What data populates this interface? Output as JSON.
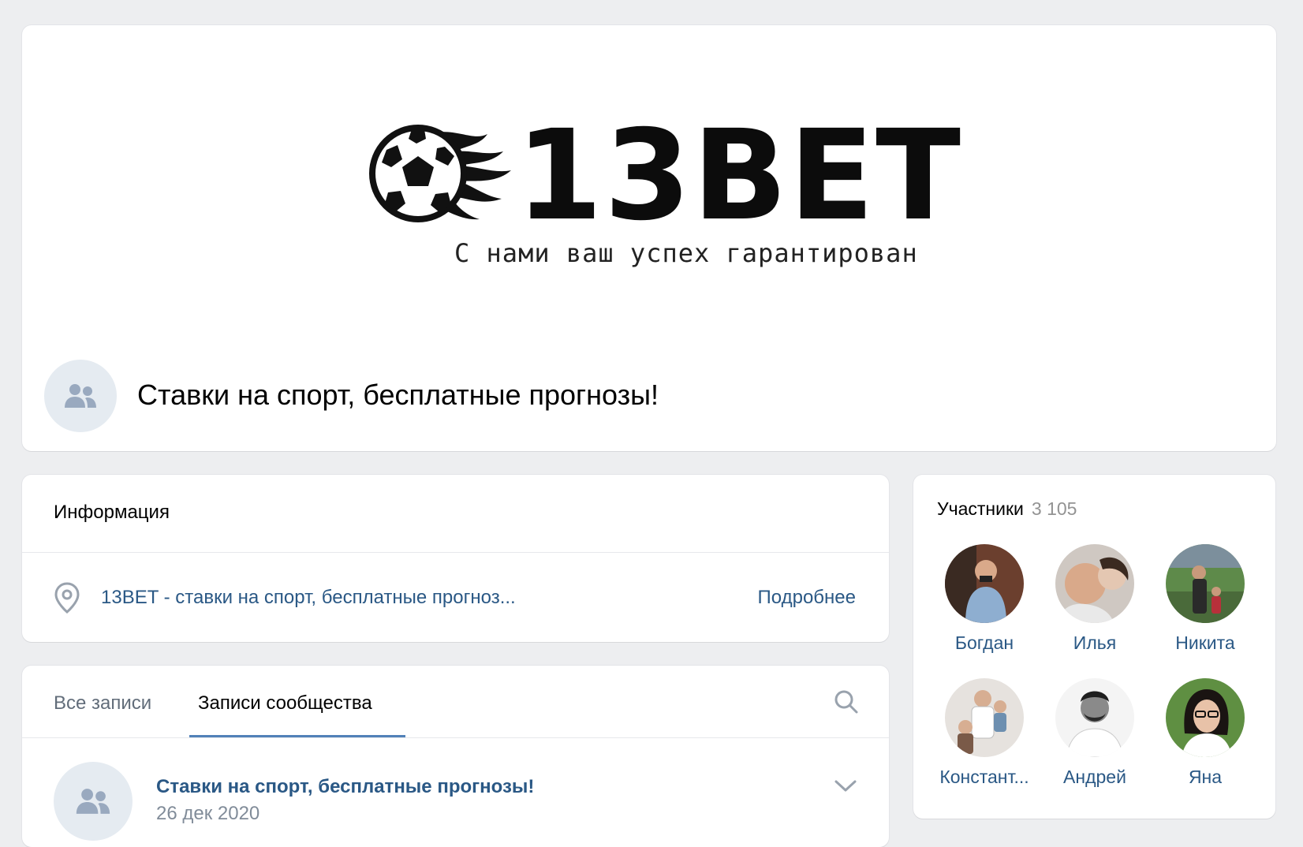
{
  "cover": {
    "logo_text": "13BET",
    "slogan": "С нами ваш успех гарантирован"
  },
  "group": {
    "name": "Ставки на спорт, бесплатные прогнозы!"
  },
  "info": {
    "title": "Информация",
    "link_text": "13BET - ставки на спорт, бесплатные прогноз...",
    "more_label": "Подробнее"
  },
  "wall": {
    "tabs": [
      {
        "label": "Все записи",
        "active": false
      },
      {
        "label": "Записи сообщества",
        "active": true
      }
    ],
    "post": {
      "author": "Ставки на спорт, бесплатные прогнозы!",
      "date": "26 дек 2020"
    }
  },
  "members": {
    "title": "Участники",
    "count": "3 105",
    "list": [
      {
        "name": "Богдан"
      },
      {
        "name": "Илья"
      },
      {
        "name": "Никита"
      },
      {
        "name": "Констант..."
      },
      {
        "name": "Андрей"
      },
      {
        "name": "Яна"
      }
    ]
  },
  "colors": {
    "page_bg": "#edeef0",
    "link": "#2a5885",
    "tab_active_underline": "#5181b8",
    "muted": "#818c99"
  }
}
